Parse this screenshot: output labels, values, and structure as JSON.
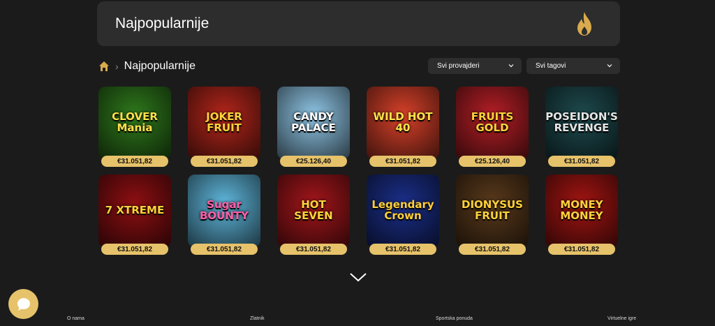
{
  "banner": {
    "title": "Najpopularnije",
    "icon": "flame-icon"
  },
  "breadcrumb": {
    "label": "Najpopularnije"
  },
  "filters": {
    "providers": "Svi provajderi",
    "tags": "Svi tagovi"
  },
  "games": [
    {
      "name": "CLOVER Mania",
      "price": "€31.051,82",
      "bg": "#2f7a1c",
      "fg": "#ffe14a"
    },
    {
      "name": "JOKER FRUIT",
      "price": "€31.051,82",
      "bg": "#b3261b",
      "fg": "#ffd23a"
    },
    {
      "name": "CANDY PALACE",
      "price": "€25.126,40",
      "bg": "#8fc6e6",
      "fg": "#ffffff"
    },
    {
      "name": "WILD HOT 40",
      "price": "€31.051,82",
      "bg": "#d8412a",
      "fg": "#ffe14a"
    },
    {
      "name": "FRUITS GOLD",
      "price": "€25.126,40",
      "bg": "#b51f26",
      "fg": "#ffd23a"
    },
    {
      "name": "POSEIDON'S REVENGE",
      "price": "€31.051,82",
      "bg": "#1e4b4f",
      "fg": "#e5e5e5"
    },
    {
      "name": "7 XTREME",
      "price": "€31.051,82",
      "bg": "#8e0f12",
      "fg": "#ffd23a"
    },
    {
      "name": "Sugar BOUNTY",
      "price": "€31.051,82",
      "bg": "#5fb7dc",
      "fg": "#ff5fa8"
    },
    {
      "name": "HOT SEVEN",
      "price": "€31.051,82",
      "bg": "#a3161b",
      "fg": "#ffd23a"
    },
    {
      "name": "Legendary Crown",
      "price": "€31.051,82",
      "bg": "#1b2f8a",
      "fg": "#ffcf3a"
    },
    {
      "name": "DIONYSUS FRUIT",
      "price": "€31.051,82",
      "bg": "#5a3a1c",
      "fg": "#ffd23a"
    },
    {
      "name": "MONEY MONEY",
      "price": "€31.051,82",
      "bg": "#a31512",
      "fg": "#ffd23a"
    }
  ],
  "footer": {
    "about": "O nama",
    "zlatnik": "Zlatnik",
    "sports": "Sportska ponuda",
    "virtual": "Virtuelne igre"
  },
  "colors": {
    "accent": "#e6c26a",
    "panel": "#2d2d2d",
    "background": "#1b1b1b"
  }
}
